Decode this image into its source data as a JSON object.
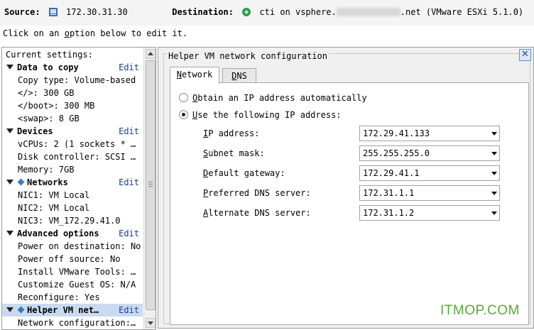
{
  "header": {
    "source_label": "Source:",
    "source_value": "172.30.31.30",
    "destination_label": "Destination:",
    "destination_prefix": "cti on vsphere.",
    "destination_suffix": ".net (VMware ESXi 5.1.0)",
    "hint_before": "Click on an ",
    "hint_option": "o",
    "hint_after": "ption below to edit it."
  },
  "left_panel": {
    "caption": "Current settings:",
    "edit_label": "Edit",
    "sections": [
      {
        "title": "Data to copy",
        "items": [
          "Copy type: Volume-based",
          "</>: 300 GB",
          "</boot>: 300 MB",
          "<swap>: 8 GB"
        ]
      },
      {
        "title": "Devices",
        "items": [
          "vCPUs: 2 (1 sockets * …",
          "Disk controller: SCSI …",
          "Memory: 7GB"
        ]
      },
      {
        "title": "Networks",
        "items": [
          "NIC1: VM Local",
          "NIC2: VM Local",
          "NIC3: VM_172.29.41.0"
        ]
      },
      {
        "title": "Advanced options",
        "items": [
          "Power on destination: No",
          "Power off source: No",
          "Install VMware Tools: …",
          "Customize Guest OS: N/A",
          "Reconfigure: Yes"
        ]
      },
      {
        "title": "Helper VM net…",
        "items": [
          "Network configuration:…"
        ]
      }
    ]
  },
  "right_panel": {
    "title": "Helper VM network configuration",
    "close_glyph": "✕",
    "tabs": [
      {
        "label_u": "N",
        "label_rest": "etwork"
      },
      {
        "label_u": "D",
        "label_rest": "NS"
      }
    ],
    "radio_auto_u": "O",
    "radio_auto_rest": "btain an IP address automatically",
    "radio_manual_u": "U",
    "radio_manual_rest": "se the following IP address:",
    "fields": [
      {
        "label_u": "I",
        "label_rest": "P address:",
        "value": "172.29.41.133"
      },
      {
        "label_u": "S",
        "label_rest": "ubnet mask:",
        "value": "255.255.255.0"
      },
      {
        "label_u": "D",
        "label_rest": "efault gateway:",
        "value": "172.29.41.1"
      },
      {
        "label_u": "P",
        "label_rest": "referred DNS server:",
        "value": "172.31.1.1"
      },
      {
        "label_u": "A",
        "label_rest": "lternate DNS server:",
        "value": "172.31.1.2"
      }
    ]
  },
  "watermark": "ITMOP.COM",
  "colors": {
    "accent": "#1a3a9a",
    "selection": "#c9daf0",
    "watermark": "#5aa83a"
  }
}
